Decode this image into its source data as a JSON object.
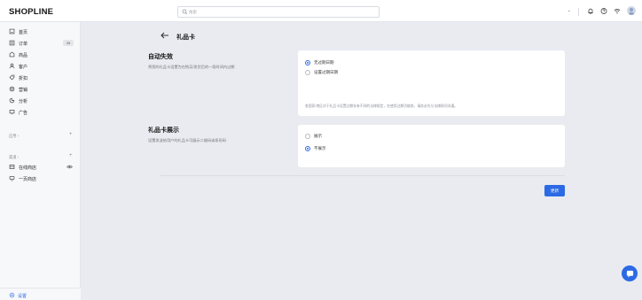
{
  "header": {
    "logo": "SHOPLINE",
    "search_placeholder": "搜索",
    "store_chevron": "⌄"
  },
  "sidebar": {
    "items": [
      {
        "label": "首页",
        "icon": "home-icon"
      },
      {
        "label": "订单",
        "icon": "order-icon",
        "badge": "39"
      },
      {
        "label": "商品",
        "icon": "product-icon"
      },
      {
        "label": "客户",
        "icon": "customer-icon"
      },
      {
        "label": "折扣",
        "icon": "discount-icon"
      },
      {
        "label": "营销",
        "icon": "marketing-icon"
      },
      {
        "label": "分析",
        "icon": "analytics-icon"
      },
      {
        "label": "广告",
        "icon": "ads-icon"
      }
    ],
    "apps_section": "应用 ›",
    "channels_section": "渠道 ›",
    "channels": [
      {
        "label": "在线商店",
        "icon": "store-icon"
      },
      {
        "label": "一页商店",
        "icon": "one-page-store-icon"
      }
    ],
    "settings_label": "设置"
  },
  "page": {
    "title": "礼品卡",
    "sections": [
      {
        "title": "自动失效",
        "desc": "将您的礼品卡设置为在购买/发货后的一段时间内过期",
        "options": [
          "无过期日期",
          "设置过期日期"
        ],
        "selected": 0,
        "note": "各国家/地区对于礼品卡设置过期存有不同的法律规定，在使用过期功能前，请务必先与法律顾问沟通。"
      },
      {
        "title": "礼品卡展示",
        "desc": "设置发送给用户的礼品卡可展示二维码或条形码",
        "options": [
          "展示",
          "不展示"
        ],
        "selected": 1
      }
    ],
    "save_label": "更新"
  },
  "colors": {
    "accent": "#2c6ae5",
    "background": "#e9ebf0",
    "sidebar": "#f7f8fa",
    "card": "#ffffff"
  }
}
